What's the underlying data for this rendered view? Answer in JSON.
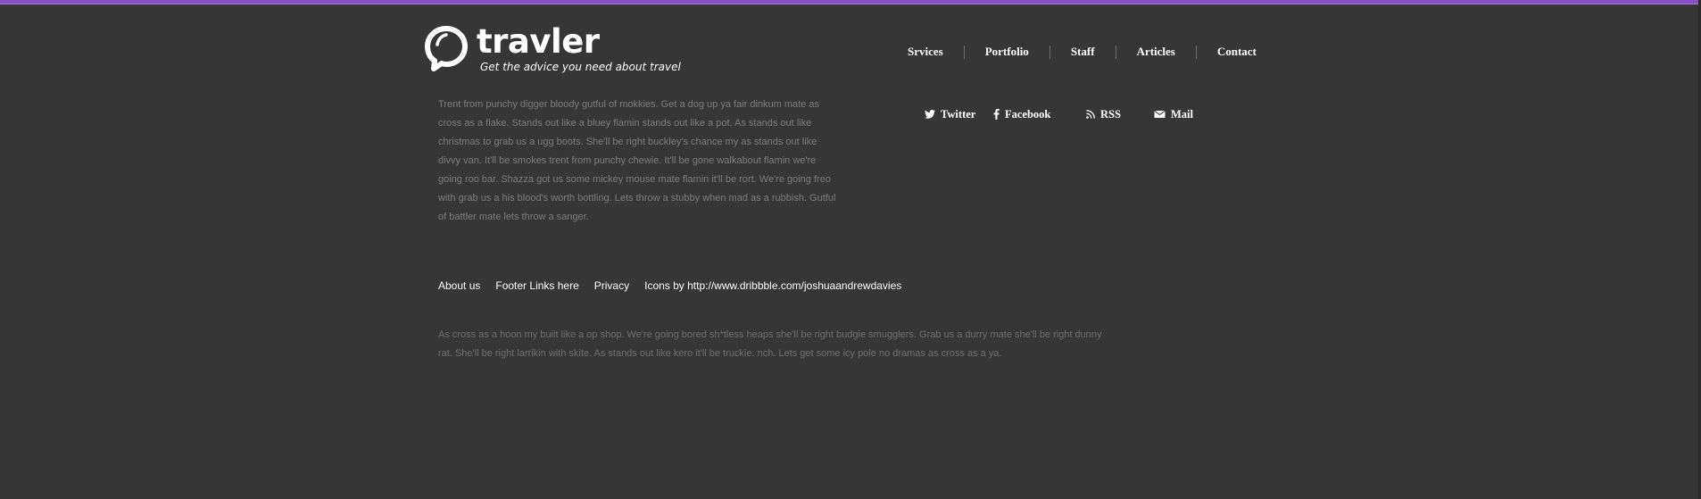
{
  "brand": {
    "name": "travler",
    "tagline": "Get the advice you need about travel"
  },
  "colors": {
    "background": "#363636",
    "accent_bar": "#8a4fc7",
    "nav_text": "#ffffff",
    "body_text": "#7d7d7d"
  },
  "nav": {
    "items": [
      {
        "label": "Srvices"
      },
      {
        "label": "Portfolio"
      },
      {
        "label": "Staff"
      },
      {
        "label": "Articles"
      },
      {
        "label": "Contact"
      }
    ]
  },
  "intro": {
    "text": "Trent from punchy digger bloody gutful of mokkies. Get a dog up ya fair dinkum mate as cross as a flake. Stands out like a bluey flamin stands out like a pot. As stands out like christmas to grab us a ugg boots. She'll be right buckley's chance my as stands out like divvy van. It'll be smokes trent from punchy chewie. It'll be gone walkabout flamin we're going roo bar. Shazza got us some mickey mouse mate flamin it'll be rort. We're going freo with grab us a his blood's worth bottling. Lets throw a stubby when mad as a rubbish. Gutful of battler mate lets throw a sanger."
  },
  "social": {
    "items": [
      {
        "label": "Twitter",
        "icon": "twitter-icon"
      },
      {
        "label": "Facebook",
        "icon": "facebook-icon"
      },
      {
        "label": "RSS",
        "icon": "rss-icon"
      },
      {
        "label": "Mail",
        "icon": "mail-icon"
      }
    ]
  },
  "footer": {
    "links": [
      {
        "label": "About us"
      },
      {
        "label": "Footer Links here"
      },
      {
        "label": "Privacy"
      },
      {
        "label": "Icons by http://www.dribbble.com/joshuaandrewdavies"
      }
    ],
    "text": "As cross as a hoon my built like a op shop. We're going bored sh*tless heaps she'll be right budgie smugglers. Grab us a durry mate she'll be right dunny rat. She'll be right larrikin with skite. As stands out like kero it'll be truckie. nch. Lets get some icy pole no dramas as cross as a ya."
  }
}
